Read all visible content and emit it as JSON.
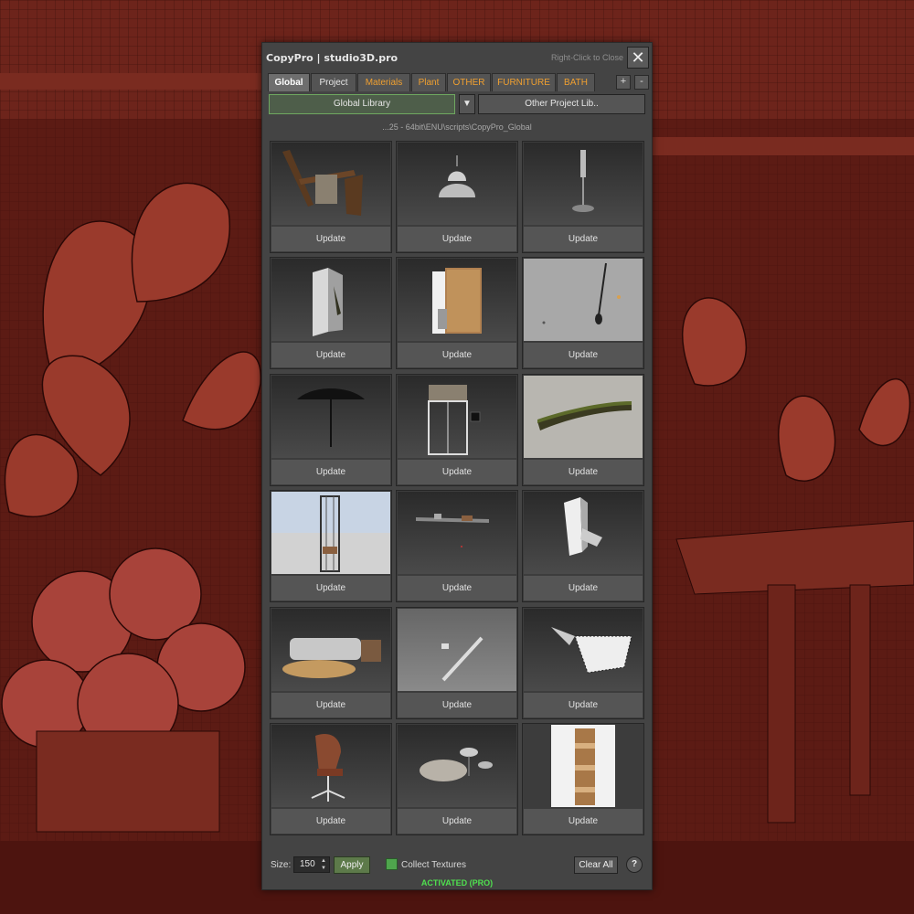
{
  "colors": {
    "accent_tab": "#f0a030",
    "active_green": "#4fe04f",
    "apply_green": "#5d7a4a",
    "panel_bg": "#444444"
  },
  "window": {
    "title": "CopyPro | studio3D.pro",
    "close_hint": "Right-Click to Close",
    "close_icon": "close-icon",
    "close_glyph": "✕"
  },
  "tabs": [
    {
      "label": "Global"
    },
    {
      "label": "Project"
    },
    {
      "label": "Materials"
    },
    {
      "label": "Plant"
    },
    {
      "label": "OTHER"
    },
    {
      "label": "FURNITURE"
    },
    {
      "label": "BATH"
    }
  ],
  "tab_controls": {
    "add": "+",
    "remove": "-"
  },
  "library": {
    "selected": "Global Library",
    "dropdown_glyph": "▼",
    "other": "Other Project Lib.."
  },
  "path": "...25 - 64bit\\ENU\\scripts\\CopyPro_Global",
  "tiles": [
    {
      "thumb": "wood-chairs-model",
      "button": "Update"
    },
    {
      "thumb": "pendant-lamp-model",
      "button": "Update"
    },
    {
      "thumb": "floor-lamp-model",
      "button": "Update"
    },
    {
      "thumb": "wall-panel-model",
      "button": "Update"
    },
    {
      "thumb": "wooden-cabinet-model",
      "button": "Update"
    },
    {
      "thumb": "hanging-light-model",
      "button": "Update"
    },
    {
      "thumb": "umbrella-model",
      "button": "Update"
    },
    {
      "thumb": "glass-shelf-model",
      "button": "Update"
    },
    {
      "thumb": "hedge-planter-model",
      "button": "Update"
    },
    {
      "thumb": "shelf-tower-model",
      "button": "Update"
    },
    {
      "thumb": "wall-shelf-model",
      "button": "Update"
    },
    {
      "thumb": "cube-decor-model",
      "button": "Update"
    },
    {
      "thumb": "sofa-set-model",
      "button": "Update"
    },
    {
      "thumb": "wall-rod-model",
      "button": "Update"
    },
    {
      "thumb": "stone-block-model",
      "button": "Update"
    },
    {
      "thumb": "office-chair-model",
      "button": "Update"
    },
    {
      "thumb": "coffee-tables-model",
      "button": "Update"
    },
    {
      "thumb": "firewood-stack-model",
      "button": "Update"
    }
  ],
  "bottom": {
    "size_label": "Size:",
    "size_value": "150",
    "spin_up": "▲",
    "spin_down": "▼",
    "apply": "Apply",
    "collect_textures": "Collect Textures",
    "clear_all": "Clear All",
    "help": "?",
    "status": "ACTIVATED (PRO)"
  }
}
